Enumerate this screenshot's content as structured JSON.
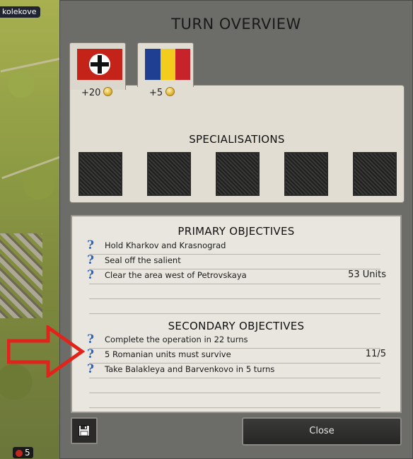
{
  "map": {
    "town_label": "kolekove",
    "badge_count": "5"
  },
  "panel": {
    "title": "TURN OVERVIEW",
    "tabs": [
      {
        "name": "germany",
        "income": "+20"
      },
      {
        "name": "romania",
        "income": "+5"
      }
    ],
    "specialisations_title": "SPECIALISATIONS",
    "specialisation_slots": 5
  },
  "objectives": {
    "primary_title": "PRIMARY OBJECTIVES",
    "primary": [
      {
        "text": "Hold Kharkov and Krasnograd",
        "value": ""
      },
      {
        "text": "Seal off the salient",
        "value": ""
      },
      {
        "text": "Clear the area west of Petrovskaya",
        "value": "53 Units"
      }
    ],
    "secondary_title": "SECONDARY OBJECTIVES",
    "secondary": [
      {
        "text": "Complete the operation in 22 turns",
        "value": ""
      },
      {
        "text": "5 Romanian units must survive",
        "value": "11/5"
      },
      {
        "text": "Take Balakleya and Barvenkovo in 5 turns",
        "value": ""
      }
    ],
    "help_glyph": "?"
  },
  "buttons": {
    "close_label": "Close"
  },
  "colors": {
    "accent_question": "#2e64b8",
    "arrow_red": "#e0241c"
  }
}
